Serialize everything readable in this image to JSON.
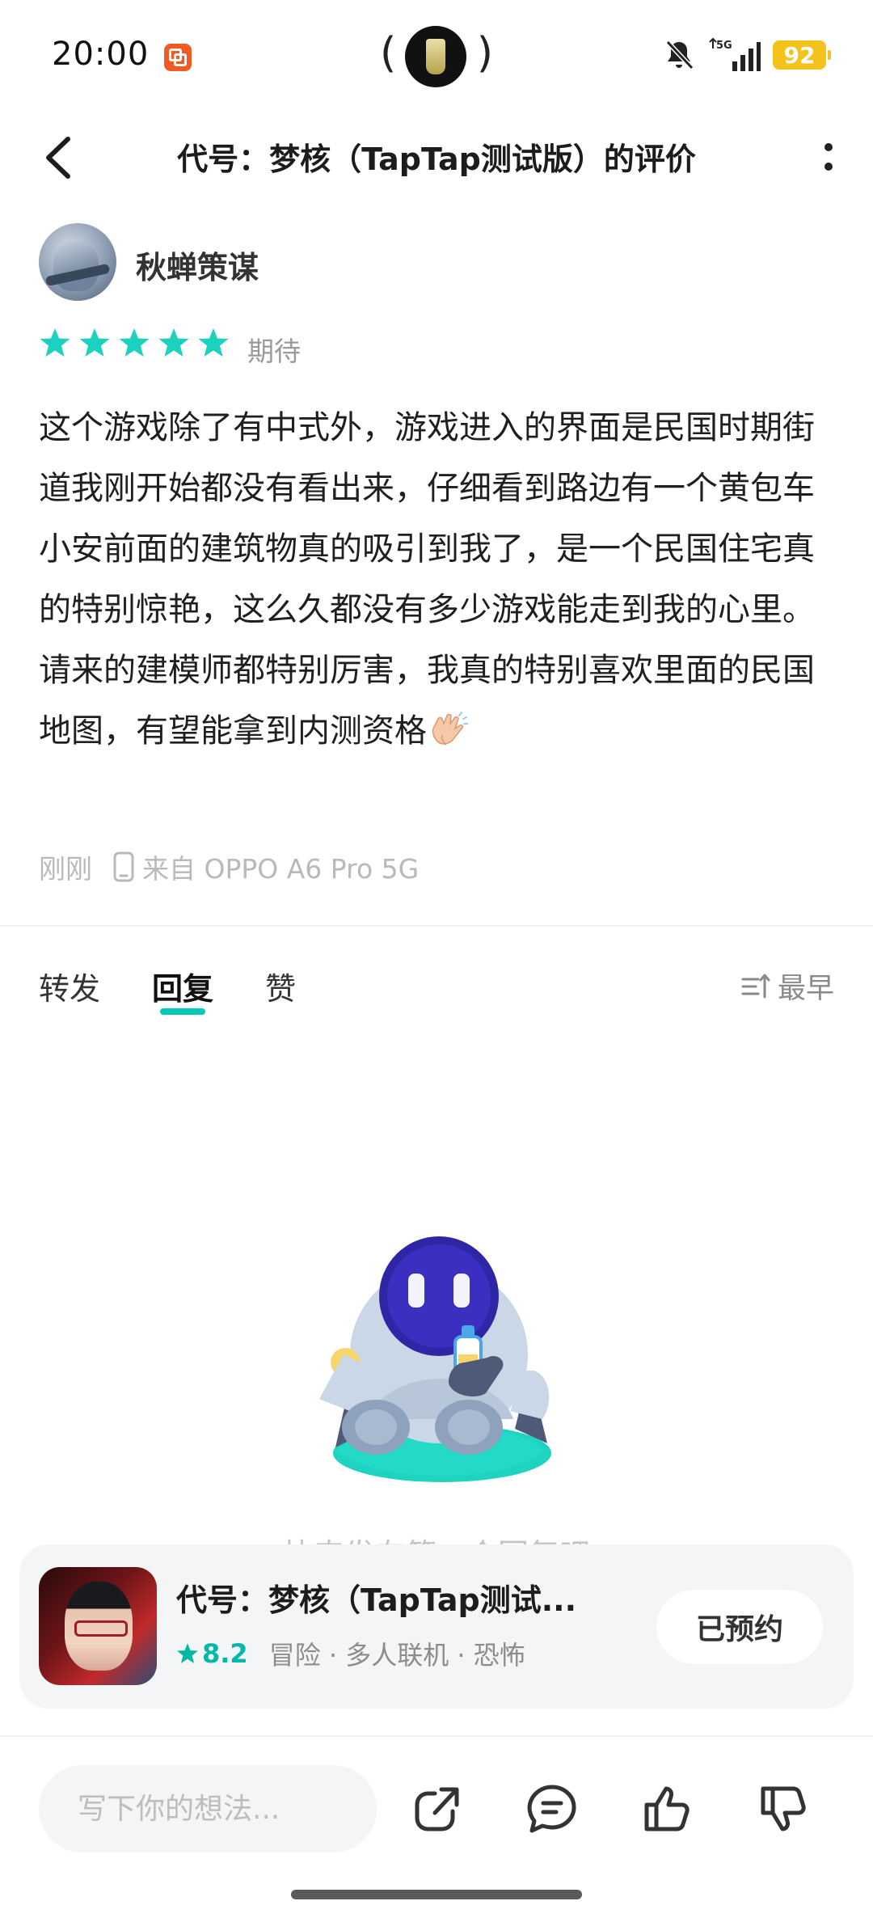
{
  "status_bar": {
    "time": "20:00",
    "network": "5G",
    "battery": "92"
  },
  "header": {
    "title": "代号：梦核（TapTap测试版）的评价"
  },
  "review": {
    "author": "秋蝉策谋",
    "stars": 5,
    "rating_label": "期待",
    "body": "这个游戏除了有中式外，游戏进入的界面是民国时期街道我刚开始都没有看出来，仔细看到路边有一个黄包车小安前面的建筑物真的吸引到我了，是一个民国住宅真的特别惊艳，这么久都没有多少游戏能走到我的心里。请来的建模师都特别厉害，我真的特别喜欢里面的民国地图，有望能拿到内测资格",
    "emoji": "clapping-hands",
    "time": "刚刚",
    "device": "来自 OPPO A6 Pro 5G"
  },
  "tabs": {
    "items": [
      "转发",
      "回复",
      "赞"
    ],
    "active": "回复",
    "sort_label": "最早"
  },
  "empty_state": {
    "text": "快来发布第一个回复吧"
  },
  "game_card": {
    "title": "代号：梦核（TapTap测试...",
    "score": "8.2",
    "tags": "冒险 · 多人联机 · 恐怖",
    "button_label": "已预约"
  },
  "bottom_bar": {
    "input_placeholder": "写下你的想法..."
  },
  "colors": {
    "accent": "#00c9b7",
    "star": "#1dd1bf",
    "battery": "#f3c21b"
  }
}
